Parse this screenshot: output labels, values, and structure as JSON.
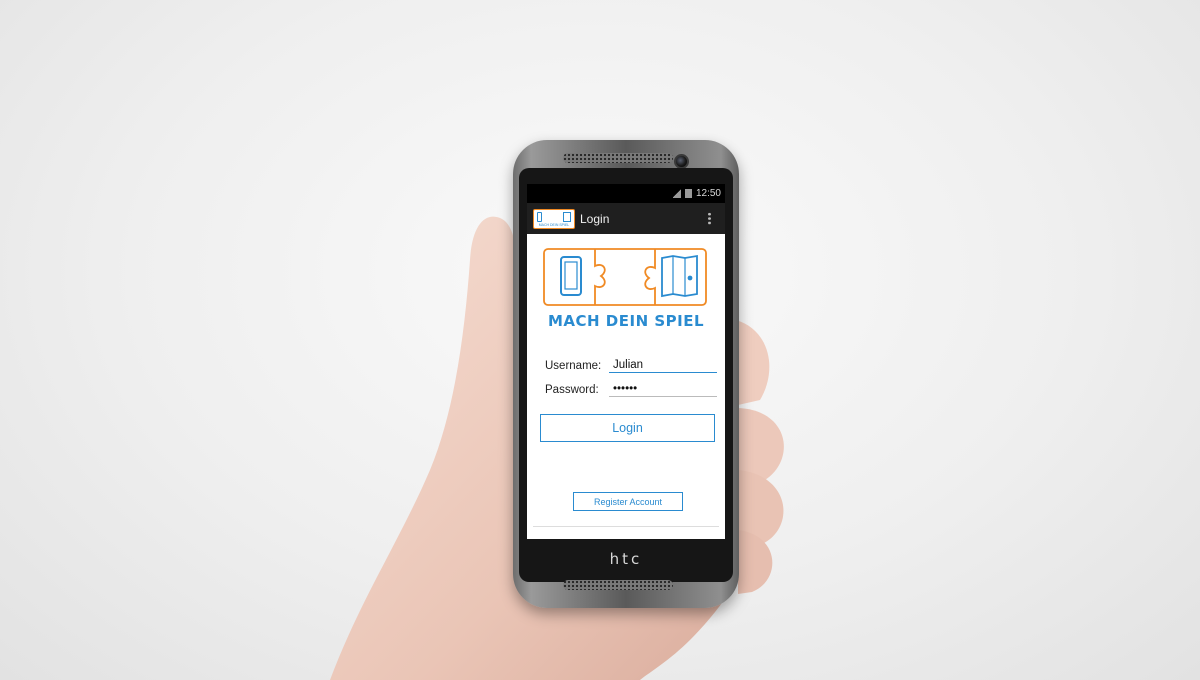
{
  "status_bar": {
    "time": "12:50"
  },
  "action_bar": {
    "title": "Login"
  },
  "logo": {
    "text": "MACH DEIN SPIEL",
    "app_icon_text": "MACH DEIN SPIEL"
  },
  "form": {
    "username_label": "Username:",
    "username_value": "Julian",
    "password_label": "Password:",
    "password_value": "••••••"
  },
  "buttons": {
    "login_label": "Login",
    "register_label": "Register Account"
  },
  "device": {
    "brand": "htc"
  },
  "colors": {
    "accent": "#2a8bd0",
    "logo_orange": "#f08a24"
  }
}
